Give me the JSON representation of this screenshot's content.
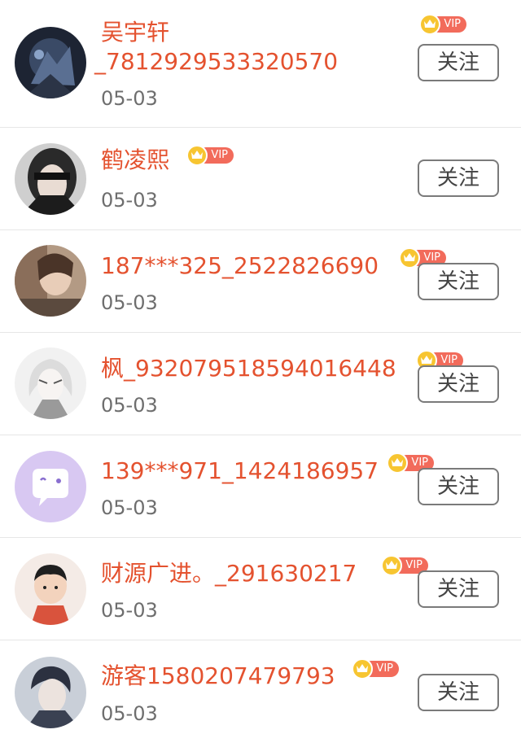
{
  "follow_label": "关注",
  "vip_label": "VIP",
  "users": [
    {
      "name": "吴宇轩",
      "name_line2": "_7812929533320570",
      "date": "05-03",
      "vip": true
    },
    {
      "name": "鹤凌熙",
      "date": "05-03",
      "vip": true
    },
    {
      "name": "187***325_2522826690",
      "date": "05-03",
      "vip": true
    },
    {
      "name": "枫_93207951859401​6448",
      "date": "05-03",
      "vip": true
    },
    {
      "name": "139***971_1424186957",
      "date": "05-03",
      "vip": true
    },
    {
      "name": "财源广进。_291630217",
      "date": "05-03",
      "vip": true
    },
    {
      "name": "游客1580207479793",
      "date": "05-03",
      "vip": true
    }
  ],
  "colors": {
    "name": "#e4522f",
    "date": "#6e6e6e",
    "vip_pill": "#f26b5b",
    "crown": "#f7c531",
    "button_border": "#7a7a7a",
    "divider": "#e6e6e6"
  },
  "icons": {
    "vip_badge": "crown-icon"
  }
}
